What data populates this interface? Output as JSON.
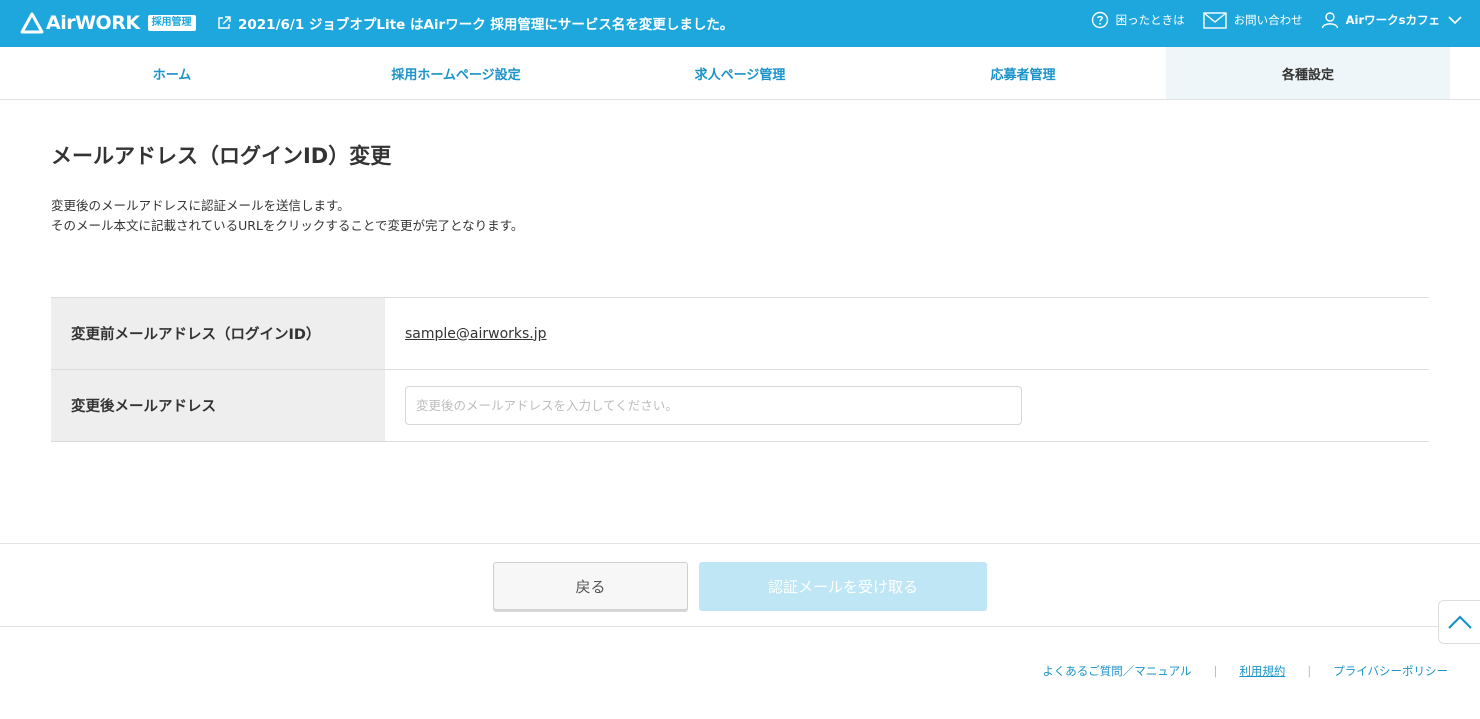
{
  "colors": {
    "header_bg": "#1ea7dd",
    "link": "#1b93c9",
    "active_tab_bg": "#eef6fa",
    "label_bg": "#eeeeee",
    "disabled_primary": "#bfe6f5"
  },
  "header": {
    "brand_name": "AirWORK",
    "brand_badge": "採用管理",
    "brand_icon": "triangle-logo-icon",
    "notice_icon": "external-link-icon",
    "notice_text": "2021/6/1 ジョブオプLite はAirワーク 採用管理にサービス名を変更しました。",
    "help_icon": "question-circle-icon",
    "help_label": "困ったときは",
    "contact_icon": "envelope-icon",
    "contact_label": "お問い合わせ",
    "user_icon": "user-icon",
    "user_label": "Airワークsカフェ",
    "user_menu_icon": "chevron-down-icon"
  },
  "nav": {
    "tabs": [
      {
        "label": "ホーム"
      },
      {
        "label": "採用ホームページ設定"
      },
      {
        "label": "求人ページ管理"
      },
      {
        "label": "応募者管理"
      },
      {
        "label": "各種設定",
        "active": true
      }
    ]
  },
  "main": {
    "title": "メールアドレス（ログインID）変更",
    "description_line1": "変更後のメールアドレスに認証メールを送信します。",
    "description_line2": "そのメール本文に記載されているURLをクリックすることで変更が完了となります。",
    "form": {
      "current_label": "変更前メールアドレス（ログインID）",
      "current_value": "sample@airworks.jp",
      "new_label": "変更後メールアドレス",
      "new_value": "",
      "new_placeholder": "変更後のメールアドレスを入力してください。"
    }
  },
  "actions": {
    "back_label": "戻る",
    "send_label": "認証メールを受け取る",
    "send_disabled": true,
    "scroll_top_icon": "chevron-up-icon"
  },
  "footer": {
    "links": [
      {
        "label": "よくあるご質問／マニュアル"
      },
      {
        "label": "利用規約"
      },
      {
        "label": "プライバシーポリシー"
      }
    ],
    "separator": "|"
  }
}
